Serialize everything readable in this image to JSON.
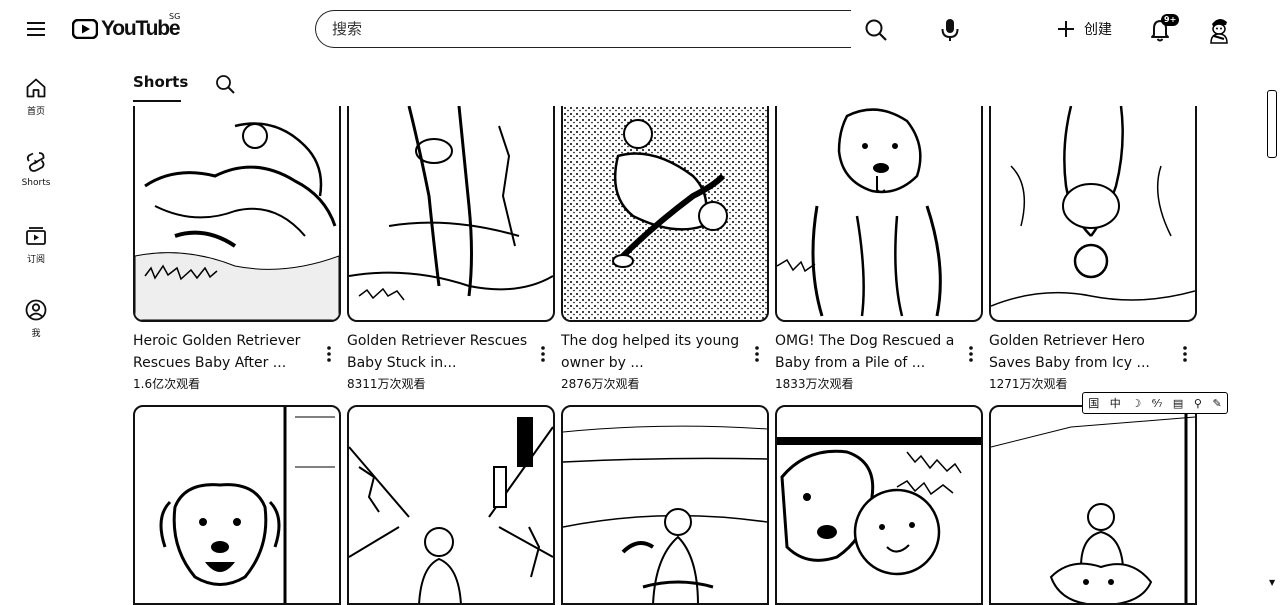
{
  "header": {
    "logo_text": "YouTube",
    "logo_region": "SG",
    "search_placeholder": "搜索",
    "create_label": "创建",
    "notification_badge": "9+"
  },
  "sidebar": {
    "items": [
      {
        "label": "首页",
        "icon": "home-icon"
      },
      {
        "label": "Shorts",
        "icon": "shorts-icon"
      },
      {
        "label": "订阅",
        "icon": "subscriptions-icon"
      },
      {
        "label": "我",
        "icon": "you-icon"
      }
    ]
  },
  "tabs": {
    "active_label": "Shorts"
  },
  "videos": [
    {
      "title": "Heroic Golden Retriever Rescues Baby After ...",
      "views": "1.6亿次观看"
    },
    {
      "title": "Golden Retriever Rescues Baby Stuck in...",
      "views": "8311万次观看"
    },
    {
      "title": "The dog helped its young owner by ...",
      "views": "2876万次观看"
    },
    {
      "title": "OMG!  The Dog Rescued a Baby from a Pile of ...",
      "views": "1833万次观看"
    },
    {
      "title": "Golden Retriever Hero Saves Baby from Icy ...",
      "views": "1271万次观看"
    }
  ],
  "extension_toolbar": {
    "items": [
      "国",
      "中",
      "☽",
      "⁶⁄₇",
      "▤",
      "⚲",
      "✎"
    ]
  }
}
